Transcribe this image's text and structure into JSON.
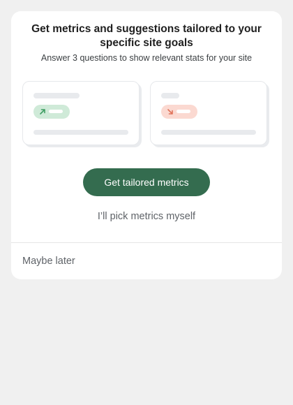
{
  "dialog": {
    "title_line1": "Get metrics and suggestions tailored to your",
    "title_line2": "specific site goals",
    "subtitle": "Answer 3 questions to show relevant stats for your site",
    "primary_button": "Get tailored metrics",
    "secondary_button": "I’ll pick metrics myself",
    "dismiss_button": "Maybe later"
  },
  "illustration": {
    "left_card": {
      "trend": "up",
      "icon": "arrow-up-right-icon",
      "color": "#cfead8"
    },
    "right_card": {
      "trend": "down",
      "icon": "arrow-down-right-icon",
      "color": "#fbd9d1"
    }
  },
  "colors": {
    "primary": "#346c4f",
    "background": "#f0f0f0"
  }
}
